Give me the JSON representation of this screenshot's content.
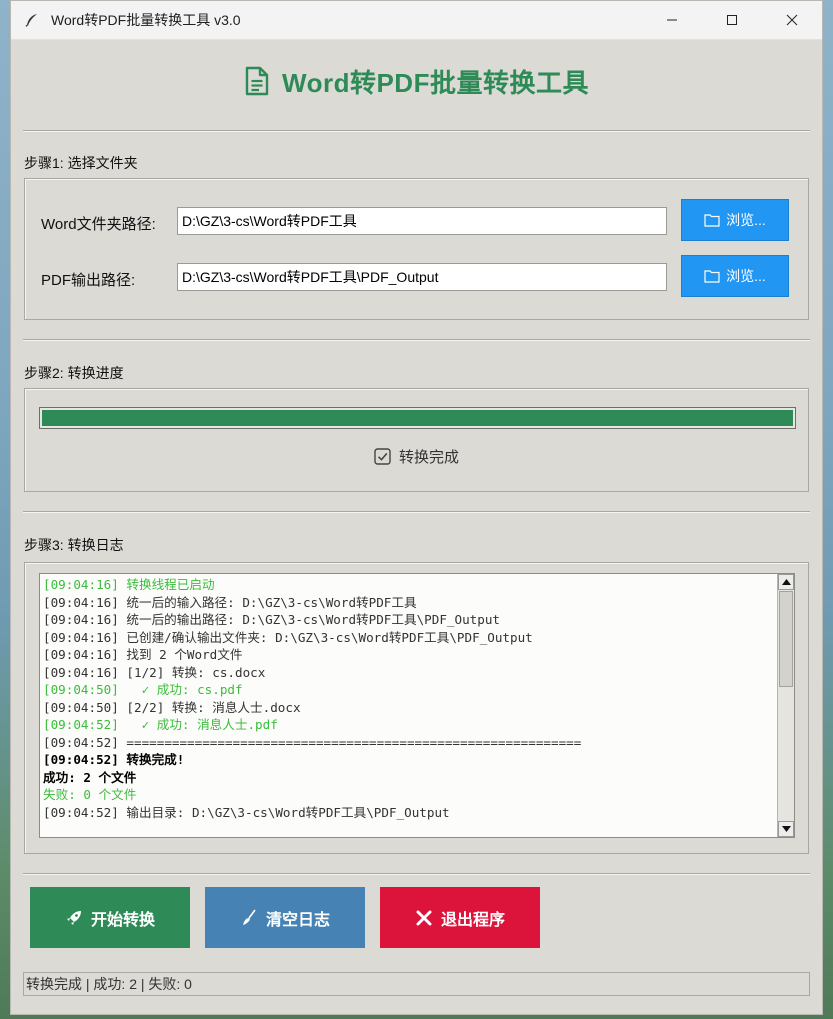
{
  "window": {
    "title": "Word转PDF批量转换工具 v3.0"
  },
  "header": {
    "title": "Word转PDF批量转换工具",
    "accent_color": "#2e8b57"
  },
  "step1": {
    "title": "步骤1: 选择文件夹",
    "word_label": "Word文件夹路径:",
    "word_path": "D:\\GZ\\3-cs\\Word转PDF工具",
    "pdf_label": "PDF输出路径:",
    "pdf_path": "D:\\GZ\\3-cs\\Word转PDF工具\\PDF_Output",
    "browse_label": "浏览...",
    "browse_color": "#2196f3"
  },
  "step2": {
    "title": "步骤2: 转换进度",
    "progress": 1.0,
    "status": "转换完成"
  },
  "step3": {
    "title": "步骤3: 转换日志",
    "log": [
      {
        "text": "[09:04:16] 转换线程已启动",
        "style": "green"
      },
      {
        "text": "[09:04:16] 统一后的输入路径: D:\\GZ\\3-cs\\Word转PDF工具",
        "style": "gray"
      },
      {
        "text": "[09:04:16] 统一后的输出路径: D:\\GZ\\3-cs\\Word转PDF工具\\PDF_Output",
        "style": "gray"
      },
      {
        "text": "[09:04:16] 已创建/确认输出文件夹: D:\\GZ\\3-cs\\Word转PDF工具\\PDF_Output",
        "style": "gray"
      },
      {
        "text": "[09:04:16] 找到 2 个Word文件",
        "style": "gray"
      },
      {
        "text": "[09:04:16] [1/2] 转换: cs.docx",
        "style": "gray"
      },
      {
        "text": "[09:04:50]   ✓ 成功: cs.pdf",
        "style": "green"
      },
      {
        "text": "[09:04:50] [2/2] 转换: 消息人士.docx",
        "style": "gray"
      },
      {
        "text": "[09:04:52]   ✓ 成功: 消息人士.pdf",
        "style": "green"
      },
      {
        "text": "[09:04:52] ============================================================",
        "style": "gray"
      },
      {
        "text": "[09:04:52] 转换完成!",
        "style": "bold"
      },
      {
        "text": "成功: 2 个文件",
        "style": "bold"
      },
      {
        "text": "失败: 0 个文件",
        "style": "green"
      },
      {
        "text": "[09:04:52] 输出目录: D:\\GZ\\3-cs\\Word转PDF工具\\PDF_Output",
        "style": "gray"
      }
    ]
  },
  "actions": {
    "start": {
      "label": "开始转换",
      "color": "#2e8b57"
    },
    "clear": {
      "label": "清空日志",
      "color": "#4682b4"
    },
    "exit": {
      "label": "退出程序",
      "color": "#dc143c"
    }
  },
  "statusbar": {
    "text": "转换完成 | 成功: 2 | 失败: 0"
  }
}
